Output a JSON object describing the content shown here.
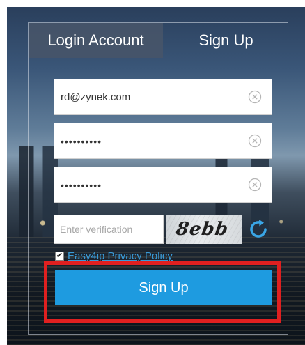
{
  "tabs": {
    "login_label": "Login Account",
    "signup_label": "Sign Up"
  },
  "form": {
    "email_value": "rd@zynek.com",
    "password_mask": "••••••••••",
    "confirm_password_mask": "••••••••••",
    "verification_placeholder": "Enter verification",
    "captcha_text": "8ebb",
    "privacy_checked": true,
    "privacy_link": "Easy4ip Privacy Policy",
    "submit_label": "Sign Up"
  },
  "colors": {
    "accent": "#1e9be0",
    "highlight": "#e02020",
    "link": "#3a9bd8"
  },
  "icons": {
    "clear": "clear-circle-x-icon",
    "refresh": "refresh-icon"
  }
}
